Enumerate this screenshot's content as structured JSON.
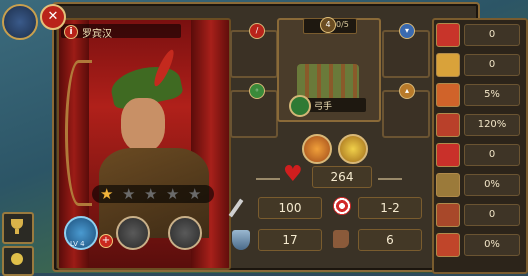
{
  "hero": {
    "name": "罗宾汉",
    "info_label": "i",
    "stars_filled": 1,
    "stars_total": 5,
    "skill_level": "LV 4"
  },
  "troop": {
    "level": "4",
    "count": "0/5",
    "name": "弓手"
  },
  "stats_center": {
    "health": "264",
    "attack": "100",
    "range": "1-2",
    "defense": "17",
    "move": "6"
  },
  "stats_right": [
    {
      "icon": "crit-icon",
      "value": "0",
      "color": "#c8342a"
    },
    {
      "icon": "speed-icon",
      "value": "0",
      "color": "#d9a23a"
    },
    {
      "icon": "fire-icon",
      "value": "5%",
      "color": "#d0632a"
    },
    {
      "icon": "power-icon",
      "value": "120%",
      "color": "#b9402a"
    },
    {
      "icon": "heal-icon",
      "value": "0",
      "color": "#c9302a"
    },
    {
      "icon": "dodge-icon",
      "value": "0%",
      "color": "#9b7a3a"
    },
    {
      "icon": "boot-icon",
      "value": "0",
      "color": "#a8482a"
    },
    {
      "icon": "flame-icon",
      "value": "0%",
      "color": "#c0452a"
    }
  ],
  "close_label": "✕",
  "colors": {
    "parchment": "#3a3226",
    "gold_border": "#8a6a38",
    "portrait_red": "#b0201a",
    "text": "#f6ebd0"
  }
}
